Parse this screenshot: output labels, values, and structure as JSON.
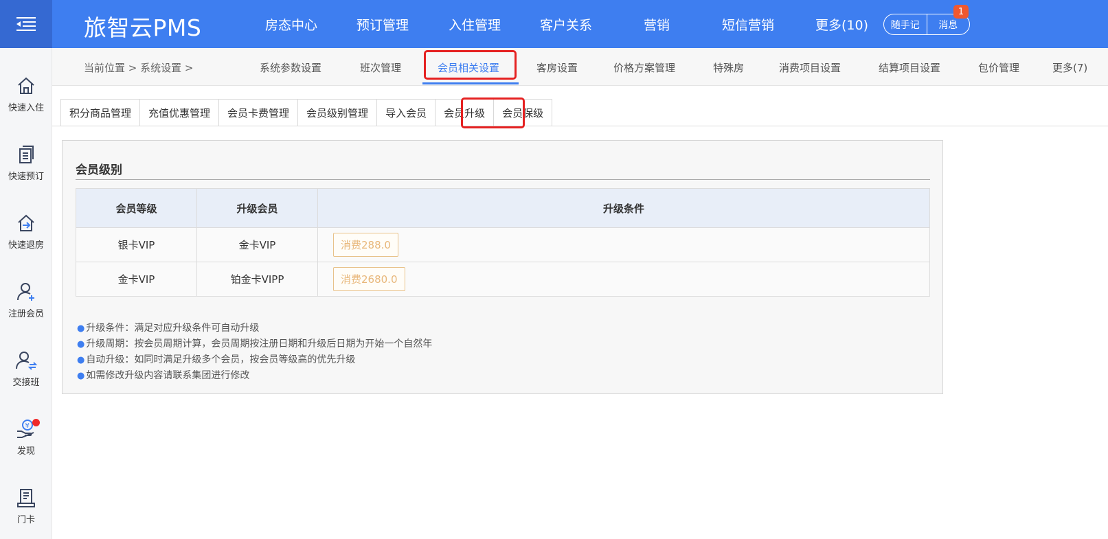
{
  "header": {
    "brand": "旅智云PMS",
    "nav": [
      "房态中心",
      "预订管理",
      "入住管理",
      "客户关系",
      "营销",
      "短信营销",
      "更多(10)"
    ],
    "pill_left": "随手记",
    "pill_right": "消息",
    "badge_count": "1"
  },
  "sidebar": {
    "items": [
      {
        "label": "快速入住",
        "icon": "home-icon"
      },
      {
        "label": "快速预订",
        "icon": "document-list-icon"
      },
      {
        "label": "快速退房",
        "icon": "checkout-home-icon"
      },
      {
        "label": "注册会员",
        "icon": "add-user-icon"
      },
      {
        "label": "交接班",
        "icon": "user-swap-icon"
      },
      {
        "label": "发现",
        "icon": "money-hand-icon"
      },
      {
        "label": "门卡",
        "icon": "card-reader-icon"
      }
    ]
  },
  "subnav": {
    "breadcrumb": "当前位置  >  系统设置   >",
    "items": [
      "系统参数设置",
      "班次管理",
      "会员相关设置",
      "客房设置",
      "价格方案管理",
      "特殊房",
      "消费项目设置",
      "结算项目设置",
      "包价管理",
      "更多(7)"
    ],
    "active_index": 2
  },
  "tabs": {
    "items": [
      "积分商品管理",
      "充值优惠管理",
      "会员卡费管理",
      "会员级别管理",
      "导入会员",
      "会员升级",
      "会员保级"
    ],
    "active_index": 5
  },
  "panel": {
    "title": "会员级别",
    "columns": [
      "会员等级",
      "升级会员",
      "升级条件"
    ],
    "rows": [
      {
        "level": "银卡VIP",
        "upgrade_to": "金卡VIP",
        "condition": "消费288.0"
      },
      {
        "level": "金卡VIP",
        "upgrade_to": "铂金卡VIPP",
        "condition": "消费2680.0"
      }
    ],
    "notes": [
      "升级条件：满足对应升级条件可自动升级",
      "升级周期：按会员周期计算，会员周期按注册日期和升级后日期为开始一个自然年",
      "自动升级：如同时满足升级多个会员，按会员等级高的优先升级",
      "如需修改升级内容请联系集团进行修改"
    ]
  },
  "colors": {
    "primary": "#3e7ef0",
    "highlight": "#e52121",
    "badge": "#f0582f",
    "condition_tag": "#e8b77a"
  }
}
